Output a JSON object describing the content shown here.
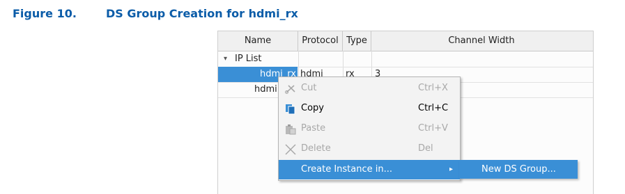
{
  "figure": {
    "number": "Figure 10.",
    "title": "DS Group Creation for hdmi_rx"
  },
  "table": {
    "headers": [
      "Name",
      "Protocol",
      "Type",
      "Channel Width"
    ],
    "group": {
      "expander": "▾",
      "label": "IP List"
    },
    "rows": [
      {
        "name": "hdmi_rx",
        "protocol": "hdmi",
        "type": "rx",
        "width": "3"
      },
      {
        "name": "hdmi",
        "protocol": "",
        "type": "",
        "width": ""
      }
    ]
  },
  "context_menu": {
    "items": [
      {
        "icon": "cut-icon",
        "label": "Cut",
        "shortcut": "Ctrl+X",
        "enabled": false
      },
      {
        "icon": "copy-icon",
        "label": "Copy",
        "shortcut": "Ctrl+C",
        "enabled": true
      },
      {
        "icon": "paste-icon",
        "label": "Paste",
        "shortcut": "Ctrl+V",
        "enabled": false
      },
      {
        "icon": "delete-icon",
        "label": "Delete",
        "shortcut": "Del",
        "enabled": false
      },
      {
        "label": "Create Instance in...",
        "submenu_arrow": "▸",
        "highlighted": true
      }
    ]
  },
  "submenu": {
    "items": [
      {
        "label": "New DS Group...",
        "highlighted": true
      }
    ]
  },
  "colors": {
    "caption": "#0b5ca8",
    "selection": "#3a8fd6"
  }
}
